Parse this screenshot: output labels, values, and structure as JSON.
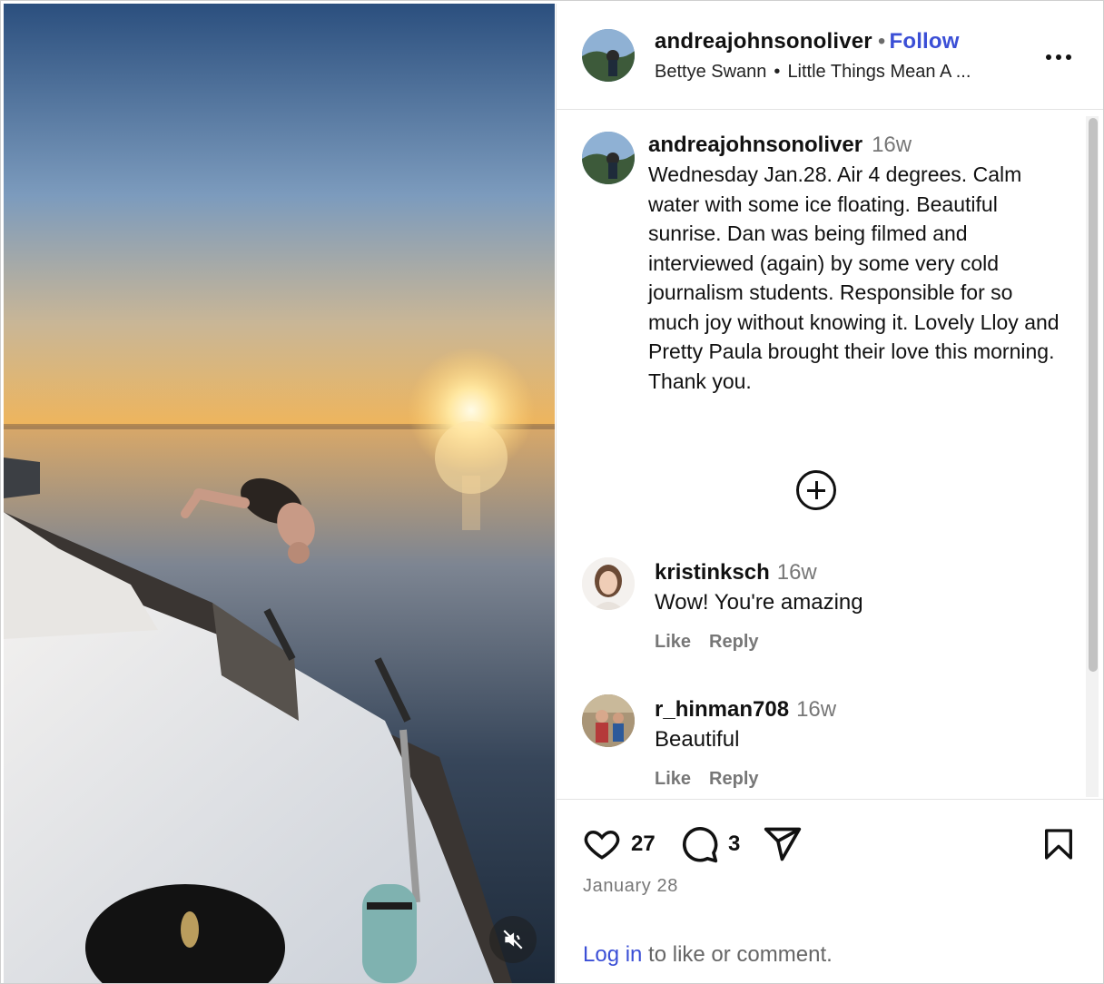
{
  "post": {
    "username": "andreajohnsonoliver",
    "follow_label": "Follow",
    "separator_dot": "•",
    "audio_artist": "Bettye Swann",
    "audio_separator": "•",
    "audio_title": "Little Things Mean A ...",
    "caption_time": "16w",
    "caption": "Wednesday Jan.28. Air 4 degrees. Calm water with some ice floating. Beautiful sunrise. Dan was being filmed and interviewed (again) by some very cold journalism students. Responsible for so much joy without knowing it. Lovely Lloy and Pretty Paula brought their love this morning. Thank you."
  },
  "comments": [
    {
      "username": "kristinksch",
      "time": "16w",
      "text": "Wow! You're amazing",
      "like_label": "Like",
      "reply_label": "Reply"
    },
    {
      "username": "r_hinman708",
      "time": "16w",
      "text": "Beautiful",
      "like_label": "Like",
      "reply_label": "Reply"
    }
  ],
  "footer": {
    "likes_count": "27",
    "comments_count": "3",
    "date": "January 28",
    "login_link": "Log in",
    "login_rest": " to like or comment."
  },
  "icons": {
    "more": "more-options-icon",
    "add": "plus-circle-icon",
    "like": "heart-icon",
    "comment": "comment-bubble-icon",
    "share": "paper-plane-icon",
    "save": "bookmark-icon",
    "mute": "speaker-muted-icon"
  },
  "colors": {
    "link_blue": "#3b4fd6",
    "muted_text": "#777777",
    "border": "#e3e3e3"
  }
}
